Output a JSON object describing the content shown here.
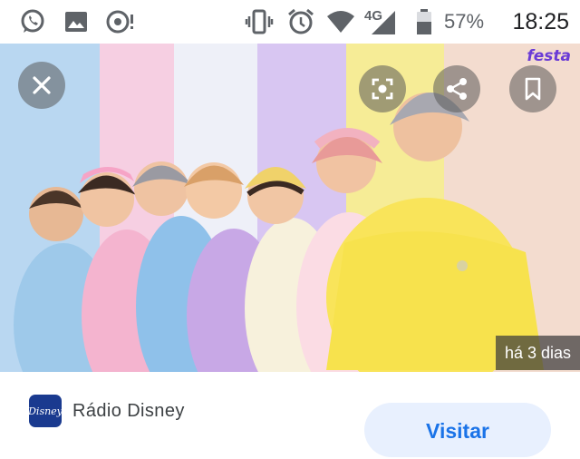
{
  "status_bar": {
    "network": "4G",
    "battery_percent": "57%",
    "time": "18:25",
    "left_icons": [
      "whatsapp-icon",
      "image-icon",
      "podcast-icon"
    ],
    "right_icons": [
      "vibrate-icon",
      "alarm-icon",
      "wifi-icon",
      "signal-icon",
      "battery-icon"
    ]
  },
  "viewer": {
    "image_age": "há 3 dias",
    "watermark": "festa"
  },
  "source": {
    "logo_text": "Disney",
    "name": "Rádio Disney",
    "visit_label": "Visitar"
  },
  "colors": {
    "stripes": [
      "#b9d7f1",
      "#f6cfe2",
      "#eef0f8",
      "#d8c6f2",
      "#f6ec96",
      "#f3dccf"
    ],
    "visit_bg": "#e8f0fe",
    "visit_text": "#1a73e8",
    "source_logo_bg": "#1a3a8f"
  }
}
